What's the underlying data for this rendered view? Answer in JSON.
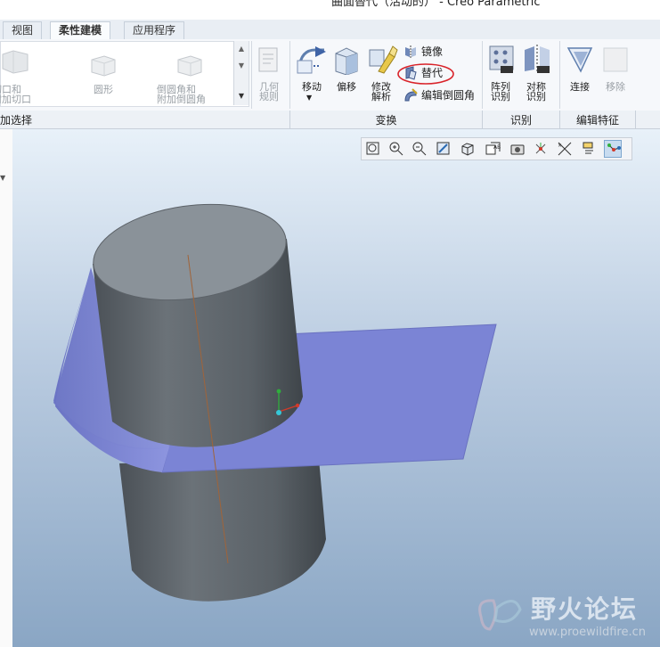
{
  "window": {
    "title": "曲面替代（活动的） - Creo Parametric"
  },
  "tabs": [
    {
      "label": "视图",
      "active": false
    },
    {
      "label": "柔性建模",
      "active": true
    },
    {
      "label": "应用程序",
      "active": false
    }
  ],
  "ribbon": {
    "gallery": {
      "items": [
        "切口和\n附加切口",
        "圆形",
        "倒圆角和\n附加倒圆角"
      ]
    },
    "geometry_rules": "几何\n规则",
    "move": "移动",
    "offset": "偏移",
    "modify_analytic": "修改\n解析",
    "mirror": "镜像",
    "substitute": "替代",
    "edit_round": "编辑倒圆角",
    "pattern_recognition": "阵列\n识别",
    "symmetry_recognition": "对称\n识别",
    "attach": "连接",
    "remove": "移除",
    "groups": {
      "shape_selection": "加选择",
      "transform": "变换",
      "recognition": "识别",
      "edit_features": "编辑特征"
    }
  },
  "view_toolbar": {
    "buttons": [
      "refit-icon",
      "zoom-in-icon",
      "zoom-out-icon",
      "repaint-icon",
      "display-style-icon",
      "saved-orientations-icon",
      "view-manager-icon",
      "datum-display-icon",
      "spin-center-icon",
      "annotation-display-icon",
      "plane-display-icon",
      "point-display-icon"
    ],
    "active": "point-display-icon"
  },
  "watermark": {
    "brand": "野火论坛",
    "url": "www.proewildfire.cn"
  },
  "colors": {
    "surface": "#7c85d6",
    "cylinder": "#5d646c",
    "cylinder_top": "#8a9299",
    "highlight_circle": "#d9232a"
  }
}
